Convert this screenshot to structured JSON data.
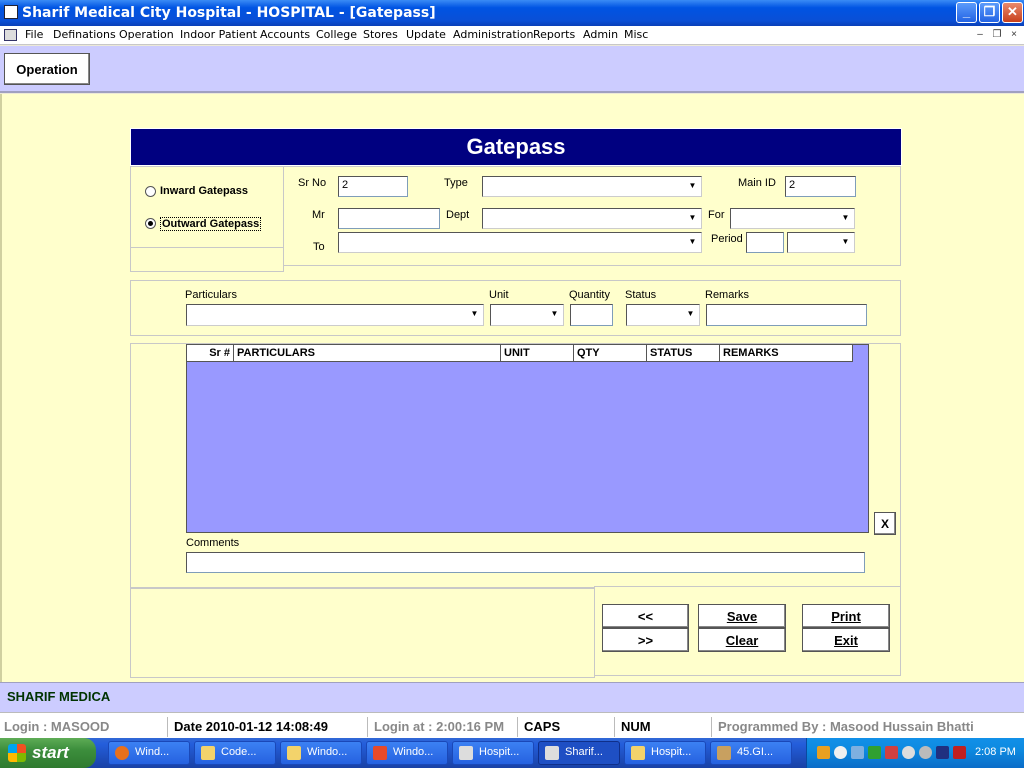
{
  "window": {
    "title": "Sharif Medical City Hospital - HOSPITAL - [Gatepass]",
    "min_glyph": "_",
    "max_glyph": "❐",
    "close_glyph": "✕"
  },
  "menu": {
    "items": [
      "File",
      "Definations",
      "Operation",
      "Indoor Patient",
      "Accounts",
      "College",
      "Stores",
      "Update",
      "Administration",
      "Reports",
      "Admin",
      "Misc"
    ],
    "mdi_min": "–",
    "mdi_restore": "❐",
    "mdi_close": "×"
  },
  "toolbar": {
    "operation_label": "Operation"
  },
  "form": {
    "title": "Gatepass",
    "radio": {
      "inward_label": "Inward Gatepass",
      "outward_label": "Outward Gatepass",
      "selected": "outward"
    },
    "labels": {
      "sr_no": "Sr No",
      "type": "Type",
      "main_id": "Main ID",
      "mr": "Mr",
      "dept": "Dept",
      "for": "For",
      "to": "To",
      "period": "Period"
    },
    "values": {
      "sr_no": "2",
      "main_id": "2",
      "mr": "",
      "type": "",
      "dept": "",
      "for": "",
      "to": "",
      "period_num": "",
      "period_unit": ""
    },
    "entry": {
      "particulars_label": "Particulars",
      "unit_label": "Unit",
      "quantity_label": "Quantity",
      "status_label": "Status",
      "remarks_label": "Remarks"
    },
    "grid": {
      "columns": [
        "Sr #",
        "PARTICULARS",
        "UNIT",
        "QTY",
        "STATUS",
        "REMARKS"
      ],
      "rows": []
    },
    "delete_row_label": "X",
    "comments_label": "Comments",
    "comments_value": "",
    "buttons": {
      "prev": "<<",
      "next": ">>",
      "save": "Save",
      "clear": "Clear",
      "print": "Print",
      "exit": "Exit"
    }
  },
  "banner": {
    "text": "SHARIF MEDICA"
  },
  "status": {
    "login": "Login :  MASOOD",
    "date": "Date 2010-01-12 14:08:49",
    "login_at": "Login at : 2:00:16 PM",
    "caps": "CAPS",
    "num": "NUM",
    "programmer": "Programmed By : Masood Hussain Bhatti"
  },
  "taskbar": {
    "start_label": "start",
    "tasks": [
      "Wind...",
      "Code...",
      "Windo...",
      "Windo...",
      "Hospit...",
      "Sharif...",
      "Hospit...",
      "45.GI..."
    ],
    "active_index": 5,
    "clock": "2:08 PM"
  }
}
